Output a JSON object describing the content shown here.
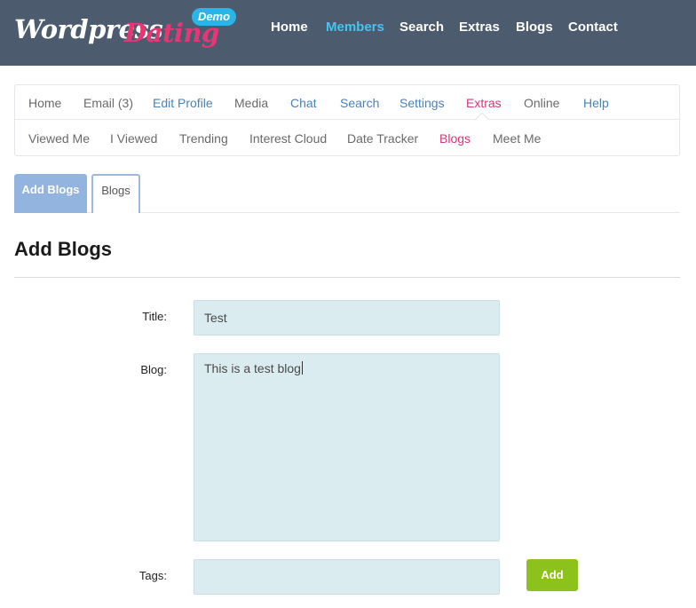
{
  "header": {
    "logo_word1": "Wordpress",
    "logo_word2": "Dating",
    "demo_badge": "Demo",
    "nav": [
      {
        "label": "Home"
      },
      {
        "label": "Members"
      },
      {
        "label": "Search"
      },
      {
        "label": "Extras"
      },
      {
        "label": "Blogs"
      },
      {
        "label": "Contact"
      }
    ],
    "active_nav": "Members",
    "colors": {
      "bar": "#4d5b6e",
      "active": "#47c3f0",
      "logo_accent": "#e83675"
    }
  },
  "subnav": {
    "row1": [
      {
        "label": "Home"
      },
      {
        "label": "Email (3)"
      },
      {
        "label": "Edit Profile"
      },
      {
        "label": "Media"
      },
      {
        "label": "Chat"
      },
      {
        "label": "Search"
      },
      {
        "label": "Settings"
      },
      {
        "label": "Extras"
      },
      {
        "label": "Online"
      },
      {
        "label": "Help"
      }
    ],
    "row2": [
      {
        "label": "Viewed Me"
      },
      {
        "label": "I Viewed"
      },
      {
        "label": "Trending"
      },
      {
        "label": "Interest Cloud"
      },
      {
        "label": "Date Tracker"
      },
      {
        "label": "Blogs"
      },
      {
        "label": "Meet Me"
      }
    ],
    "active_items": [
      "Extras",
      "Blogs"
    ]
  },
  "tabs": [
    {
      "label": "Add Blogs",
      "selected": true
    },
    {
      "label": "Blogs",
      "selected": false
    }
  ],
  "page_title": "Add Blogs",
  "form": {
    "title_label": "Title:",
    "title_value": "Test",
    "blog_label": "Blog:",
    "blog_value": "This is a test blog",
    "tags_label": "Tags:",
    "tags_value": "",
    "add_button": "Add"
  }
}
